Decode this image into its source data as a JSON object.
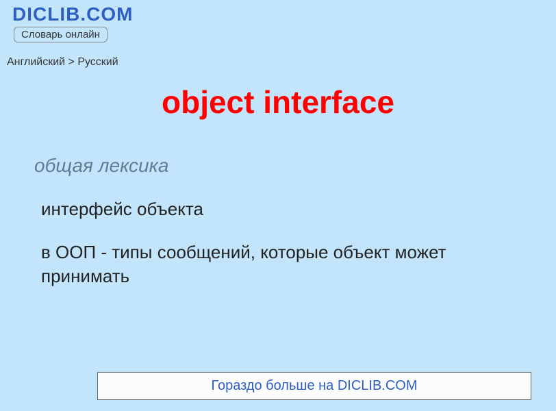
{
  "header": {
    "site_name": "DICLIB.COM",
    "tagline": "Словарь онлайн"
  },
  "breadcrumb": {
    "text": "Английский > Русский"
  },
  "entry": {
    "term": "object interface",
    "category": "общая лексика",
    "definitions": [
      "интерфейс объекта",
      "в ООП - типы сообщений, которые объект может принимать"
    ]
  },
  "footer": {
    "more_link_text": "Гораздо больше на DICLIB.COM"
  }
}
